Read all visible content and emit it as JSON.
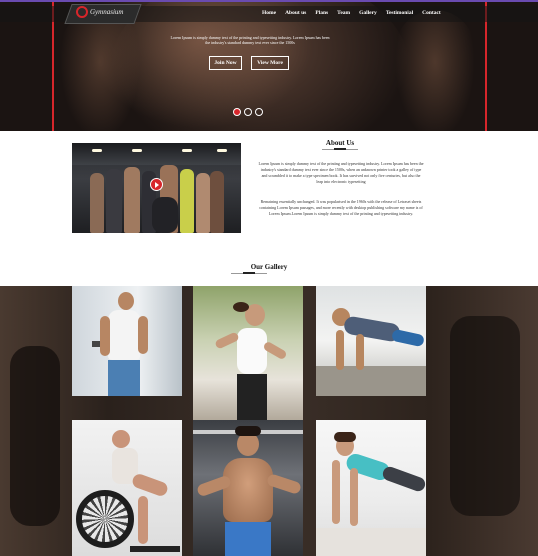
{
  "nav": {
    "logo_text": "Gymnasium",
    "items": [
      "Home",
      "About us",
      "Plans",
      "Team",
      "Gallery",
      "Testimonial",
      "Contact"
    ]
  },
  "hero": {
    "text": "Lorem Ipsum is simply dummy text of the printing and typesetting industry. Lorem Ipsum has been the industry's standard dummy text ever since the 1500s",
    "buttons": [
      "Join Now",
      "View More"
    ],
    "slider_dots": 3,
    "active_dot": 0
  },
  "about": {
    "title": "About Us",
    "paragraph1": "Lorem Ipsum is simply dummy text of the printing and typesetting industry. Lorem Ipsum has been the industry's standard dummy text ever since the 1500s, when an unknown printer took a galley of type and scrambled it to make a type specimen book. It has survived not only five centuries, but also the leap into electronic typesetting",
    "paragraph2": "Remaining essentially unchanged. It was popularised in the 1960s with the release of Letraset sheets containing Lorem Ipsum passages, and more recently with desktop publishing software my name is of Lorem Ipsum.Lorem Ipsum is simply dummy text of the printing and typesetting industry."
  },
  "gallery": {
    "title": "Our Gallery",
    "tiles": [
      "man-with-phone",
      "woman-running",
      "man-pushup",
      "woman-air-bike",
      "man-shirtless",
      "woman-plank"
    ]
  },
  "colors": {
    "accent": "#d7262b",
    "nav_top": "#6a4bb0"
  }
}
